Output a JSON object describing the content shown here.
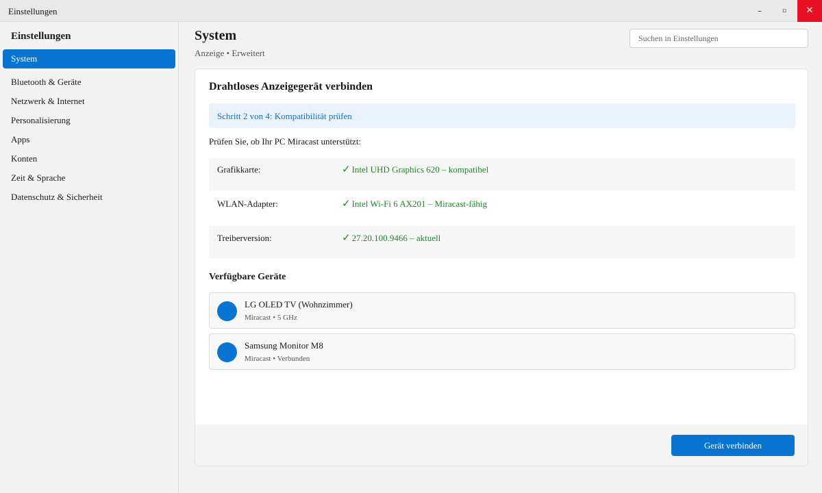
{
  "window": {
    "title": "Einstellungen",
    "minimize_icon": "–",
    "maximize_icon": "▫",
    "close_icon": "✕"
  },
  "sidebar": {
    "title": "Einstellungen",
    "items": [
      {
        "label": "System",
        "active": true
      },
      {
        "label": "Bluetooth & Geräte"
      },
      {
        "label": "Netzwerk & Internet"
      },
      {
        "label": "Personalisierung"
      },
      {
        "label": "Apps"
      },
      {
        "label": "Konten"
      },
      {
        "label": "Zeit & Sprache"
      },
      {
        "label": "Datenschutz & Sicherheit"
      }
    ]
  },
  "header": {
    "title": "System",
    "breadcrumb": "Anzeige • Erweitert",
    "search_placeholder": "Suchen in Einstellungen"
  },
  "card": {
    "title": "Drahtloses Anzeigegerät verbinden",
    "step": "Schritt 2 von 4: Kompatibilität prüfen",
    "intro": "Prüfen Sie, ob Ihr PC Miracast unterstützt:",
    "check_icon": "✓",
    "checks": [
      {
        "label": "Grafikkarte:",
        "value": "Intel UHD Graphics 620 – kompatibel"
      },
      {
        "label": "WLAN-Adapter:",
        "value": "Intel Wi-Fi 6 AX201 – Miracast-fähig"
      },
      {
        "label": "Treiberversion:",
        "value": "27.20.100.9466 – aktuell"
      }
    ],
    "devices_title": "Verfügbare Geräte",
    "devices": [
      {
        "name": "LG OLED TV (Wohnzimmer)",
        "meta": "Miracast • 5 GHz"
      },
      {
        "name": "Samsung Monitor M8",
        "meta": "Miracast • Verbunden"
      }
    ],
    "connect_label": "Gerät verbinden"
  },
  "colors": {
    "accent": "#0a74d2",
    "success": "#1b8a2a",
    "close": "#e81123",
    "banner": "#eaf3fc"
  }
}
